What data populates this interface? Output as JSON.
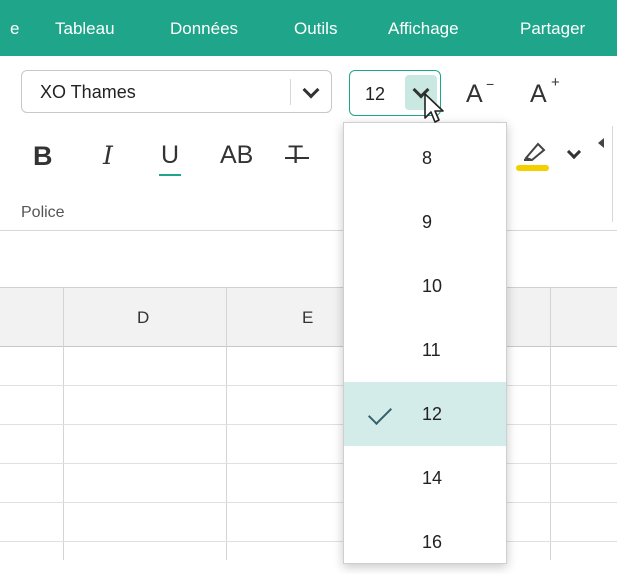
{
  "menubar": {
    "items": [
      "e",
      "Tableau",
      "Données",
      "Outils",
      "Affichage",
      "Partager"
    ]
  },
  "ribbon": {
    "font_name": "XO Thames",
    "font_size": "12",
    "decrease_font_label": "A",
    "increase_font_label": "A",
    "bold_label": "B",
    "italic_label": "I",
    "underline_label": "U",
    "caps_label": "AB",
    "strike_label": "T",
    "group_label": "Police",
    "highlight_color": "#f5d000"
  },
  "sheet": {
    "columns": [
      "D",
      "E"
    ]
  },
  "size_dropdown": {
    "options": [
      "8",
      "9",
      "10",
      "11",
      "12",
      "14",
      "16"
    ],
    "selected": "12"
  },
  "colors": {
    "accent": "#1fa68a",
    "selected_option_bg": "#d3ecea"
  }
}
